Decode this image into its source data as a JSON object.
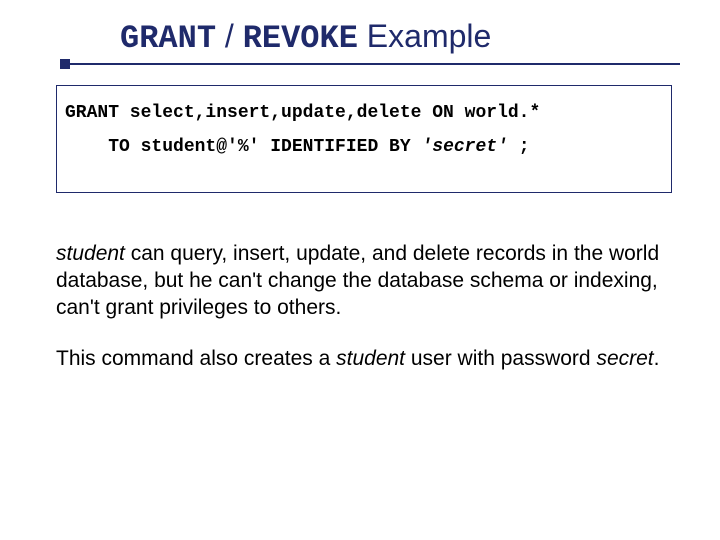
{
  "title": {
    "part1": "GRANT",
    "sep": " / ",
    "part2": "REVOKE",
    "rest": " Example"
  },
  "code": {
    "line1": "GRANT select,insert,update,delete ON world.*",
    "line2_prefix": "    TO student@'%' IDENTIFIED BY ",
    "line2_secret": "'secret'",
    "line2_suffix": " ;"
  },
  "para1": {
    "em": "student",
    "rest": " can query, insert, update, and delete records in the world database, but he can't change the database schema or indexing, can't grant privileges to others."
  },
  "para2": {
    "t1": "This command also creates a ",
    "em1": "student",
    "t2": " user with password ",
    "em2": "secret",
    "t3": "."
  }
}
